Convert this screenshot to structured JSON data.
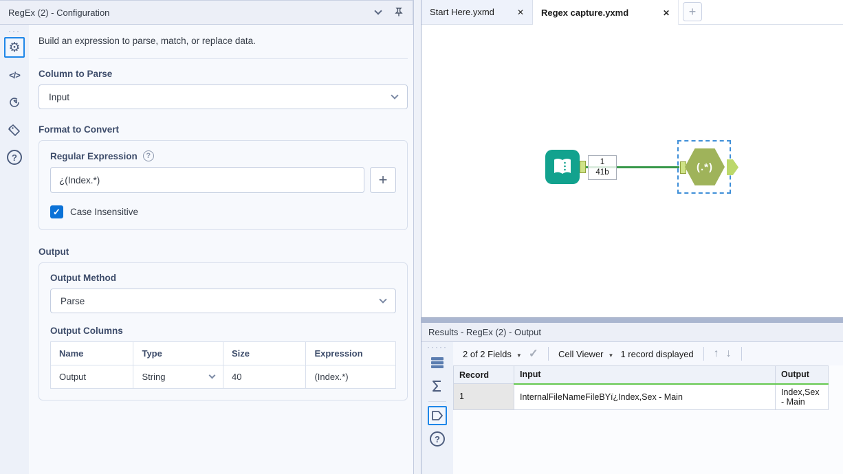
{
  "config_panel": {
    "title": "RegEx (2) - Configuration",
    "sidebar_icons": [
      "gear-icon",
      "code-icon",
      "refresh-arrow-icon",
      "tag-icon",
      "help-icon"
    ],
    "description": "Build an expression to parse, match, or replace data.",
    "column_to_parse": {
      "label": "Column to Parse",
      "value": "Input"
    },
    "format_to_convert": {
      "label": "Format to Convert",
      "regex_label": "Regular Expression",
      "regex_value": "¿(Index.*)",
      "case_insensitive_label": "Case Insensitive",
      "case_insensitive_checked": true
    },
    "output": {
      "label": "Output",
      "method_label": "Output Method",
      "method_value": "Parse",
      "columns_label": "Output Columns",
      "table": {
        "headers": [
          "Name",
          "Type",
          "Size",
          "Expression"
        ],
        "row": {
          "name": "Output",
          "type": "String",
          "size": "40",
          "expression": "(Index.*)"
        }
      }
    }
  },
  "workspace": {
    "tabs": [
      {
        "label": "Start Here.yxmd",
        "active": false
      },
      {
        "label": "Regex capture.yxmd",
        "active": true
      }
    ],
    "canvas": {
      "input_tool": "text-input-tool",
      "connection_count": "1",
      "connection_size": "41b",
      "regex_tool_label": "(.*)"
    }
  },
  "results_panel": {
    "title": "Results - RegEx (2) - Output",
    "strip_icons": [
      "table-rows-icon",
      "sigma-icon",
      "data-page-icon",
      "help-icon"
    ],
    "toolbar": {
      "fields_dropdown": "2 of 2 Fields",
      "cell_viewer_dropdown": "Cell Viewer",
      "records_text": "1 record displayed"
    },
    "table": {
      "headers": [
        "Record",
        "Input",
        "Output"
      ],
      "rows": [
        {
          "record": "1",
          "input": "InternalFileNameFileBYï¿Index,Sex - Main",
          "output": "Index,Sex - Main"
        }
      ]
    }
  },
  "colors": {
    "accent_blue": "#1d86e8",
    "checkbox_blue": "#0b72d7",
    "tool_teal": "#12a28e",
    "tool_olive": "#9fb35a",
    "connection_green": "#37984a",
    "results_green_underline": "#64c84e"
  }
}
